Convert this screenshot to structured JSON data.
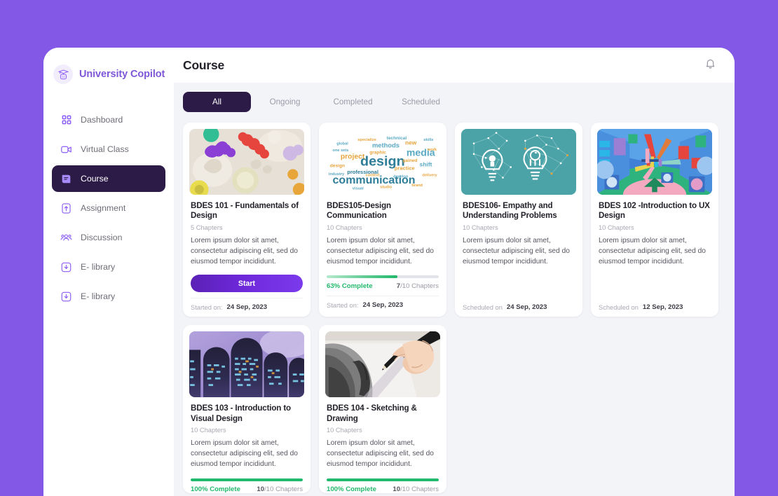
{
  "theme": {
    "page_bg": "#8458E6",
    "accent_purple": "#7E57D8",
    "dark_nav": "#2C1B47",
    "progress_green": "#21B96B",
    "content_bg": "#F3F4F8"
  },
  "brand": {
    "name": "University Copilot",
    "logo_icon": "graduation-cap-robot-icon"
  },
  "sidebar": {
    "items": [
      {
        "label": "Dashboard",
        "icon": "grid-squares-icon",
        "active": false
      },
      {
        "label": "Virtual Class",
        "icon": "video-camera-icon",
        "active": false
      },
      {
        "label": "Course",
        "icon": "book-icon",
        "active": true
      },
      {
        "label": "Assignment",
        "icon": "upload-file-icon",
        "active": false
      },
      {
        "label": "Discussion",
        "icon": "people-group-icon",
        "active": false
      },
      {
        "label": "E- library",
        "icon": "download-box-icon",
        "active": false
      },
      {
        "label": "E- library",
        "icon": "download-box-icon",
        "active": false
      }
    ]
  },
  "header": {
    "title": "Course",
    "notification_icon": "bell-icon"
  },
  "tabs": [
    {
      "label": "All",
      "active": true
    },
    {
      "label": "Ongoing",
      "active": false
    },
    {
      "label": "Completed",
      "active": false
    },
    {
      "label": "Scheduled",
      "active": false
    }
  ],
  "courses": [
    {
      "title": "BDES 101 - Fundamentals of Design",
      "chapters": "5 Chapters",
      "description": "Lorem ipsum dolor sit amet, consectetur adipiscing elit, sed do eiusmod tempor incididunt.",
      "action_label": "Start",
      "state": "start",
      "foot_label": "Started on:",
      "foot_date": "24 Sep, 2023",
      "thumb": "clay-shapes"
    },
    {
      "title": "BDES105-Design Communication",
      "chapters": "10 Chapters",
      "description": "Lorem ipsum dolor sit amet, consectetur adipiscing elit, sed do eiusmod tempor incididunt.",
      "state": "progress",
      "progress_pct": 63,
      "progress_label": "63% Complete",
      "progress_count_done": "7",
      "progress_count_rest": "/10 Chapters",
      "foot_label": "Started on:",
      "foot_date": "24 Sep, 2023",
      "thumb": "word-cloud"
    },
    {
      "title": "BDES106- Empathy and Understanding Problems",
      "chapters": "10 Chapters",
      "description": "Lorem ipsum dolor sit amet, consectetur adipiscing elit, sed do eiusmod tempor incididunt.",
      "state": "scheduled",
      "foot_label": "Scheduled on",
      "foot_date": "24 Sep, 2023",
      "thumb": "lightbulbs"
    },
    {
      "title": "BDES 102 -Introduction to UX Design",
      "chapters": "10 Chapters",
      "description": "Lorem ipsum dolor sit amet, consectetur adipiscing elit, sed do eiusmod tempor incididunt.",
      "state": "scheduled",
      "foot_label": "Scheduled on",
      "foot_date": "12 Sep, 2023",
      "thumb": "retro-corridor"
    },
    {
      "title": "BDES 103 - Introduction to Visual Design",
      "chapters": "10 Chapters",
      "description": "Lorem ipsum dolor sit amet, consectetur adipiscing elit, sed do eiusmod tempor incididunt.",
      "state": "progress",
      "progress_pct": 100,
      "progress_label": "100% Complete",
      "progress_count_done": "10",
      "progress_count_rest": "/10 Chapters",
      "thumb": "purple-towers"
    },
    {
      "title": "BDES 104 - Sketching & Drawing",
      "chapters": "10 Chapters",
      "description": "Lorem ipsum dolor sit amet, consectetur adipiscing elit, sed do eiusmod tempor incididunt.",
      "state": "progress",
      "progress_pct": 100,
      "progress_label": "100% Complete",
      "progress_count_done": "10",
      "progress_count_rest": "/10 Chapters",
      "thumb": "pencil-sketch"
    }
  ]
}
